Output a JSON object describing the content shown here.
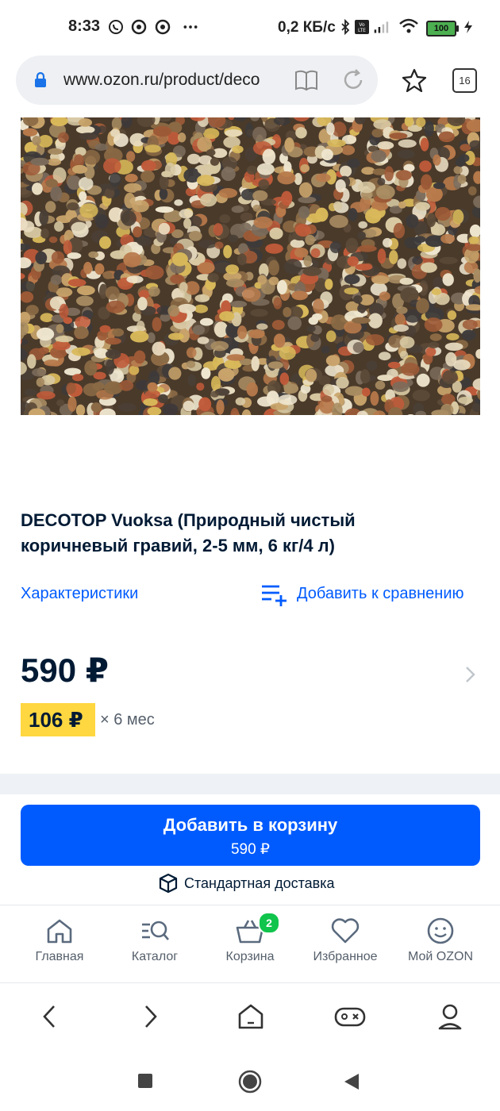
{
  "status_bar": {
    "time": "8:33",
    "network_speed": "0,2 КБ/с",
    "battery": "100",
    "icons": [
      "whatsapp-icon",
      "chrome-icon",
      "chrome-icon",
      "more-dots-icon",
      "bluetooth-icon",
      "volte-icon",
      "signal-icon",
      "wifi-icon",
      "battery-icon",
      "charging-icon"
    ]
  },
  "browser": {
    "url": "www.ozon.ru/product/deco",
    "tabs_count": "16",
    "icons": [
      "lock-icon",
      "reader-mode-icon",
      "reload-icon",
      "bookmark-star-icon",
      "tabs-icon"
    ]
  },
  "product": {
    "image_alt": "gravel-photo",
    "title": "DECOTOP Vuoksa (Природный чистый коричневый гравий, 2-5 мм, 6 кг/4 л)",
    "characteristics_link": "Характеристики",
    "compare_link": "Добавить к сравнению",
    "price": "590 ₽",
    "installment_price": "106 ₽",
    "installment_term": "× 6 мес"
  },
  "cart_button": {
    "label": "Добавить в корзину",
    "price": "590 ₽"
  },
  "delivery": {
    "label": "Стандартная доставка"
  },
  "bottom_nav": {
    "items": [
      {
        "label": "Главная",
        "icon": "home-icon"
      },
      {
        "label": "Каталог",
        "icon": "catalog-search-icon"
      },
      {
        "label": "Корзина",
        "icon": "cart-icon",
        "badge": "2"
      },
      {
        "label": "Избранное",
        "icon": "heart-icon"
      },
      {
        "label": "Мой OZON",
        "icon": "profile-smile-icon"
      }
    ]
  },
  "browser_nav": {
    "icons": [
      "back-arrow-icon",
      "forward-arrow-icon",
      "home-icon",
      "gamepad-icon",
      "profile-icon"
    ]
  },
  "system_nav": {
    "icons": [
      "recents-square-icon",
      "home-circle-icon",
      "back-triangle-icon"
    ]
  },
  "colors": {
    "accent": "#005bff",
    "installment_bg": "#ffd740",
    "badge": "#10c44c",
    "text": "#001a34"
  }
}
